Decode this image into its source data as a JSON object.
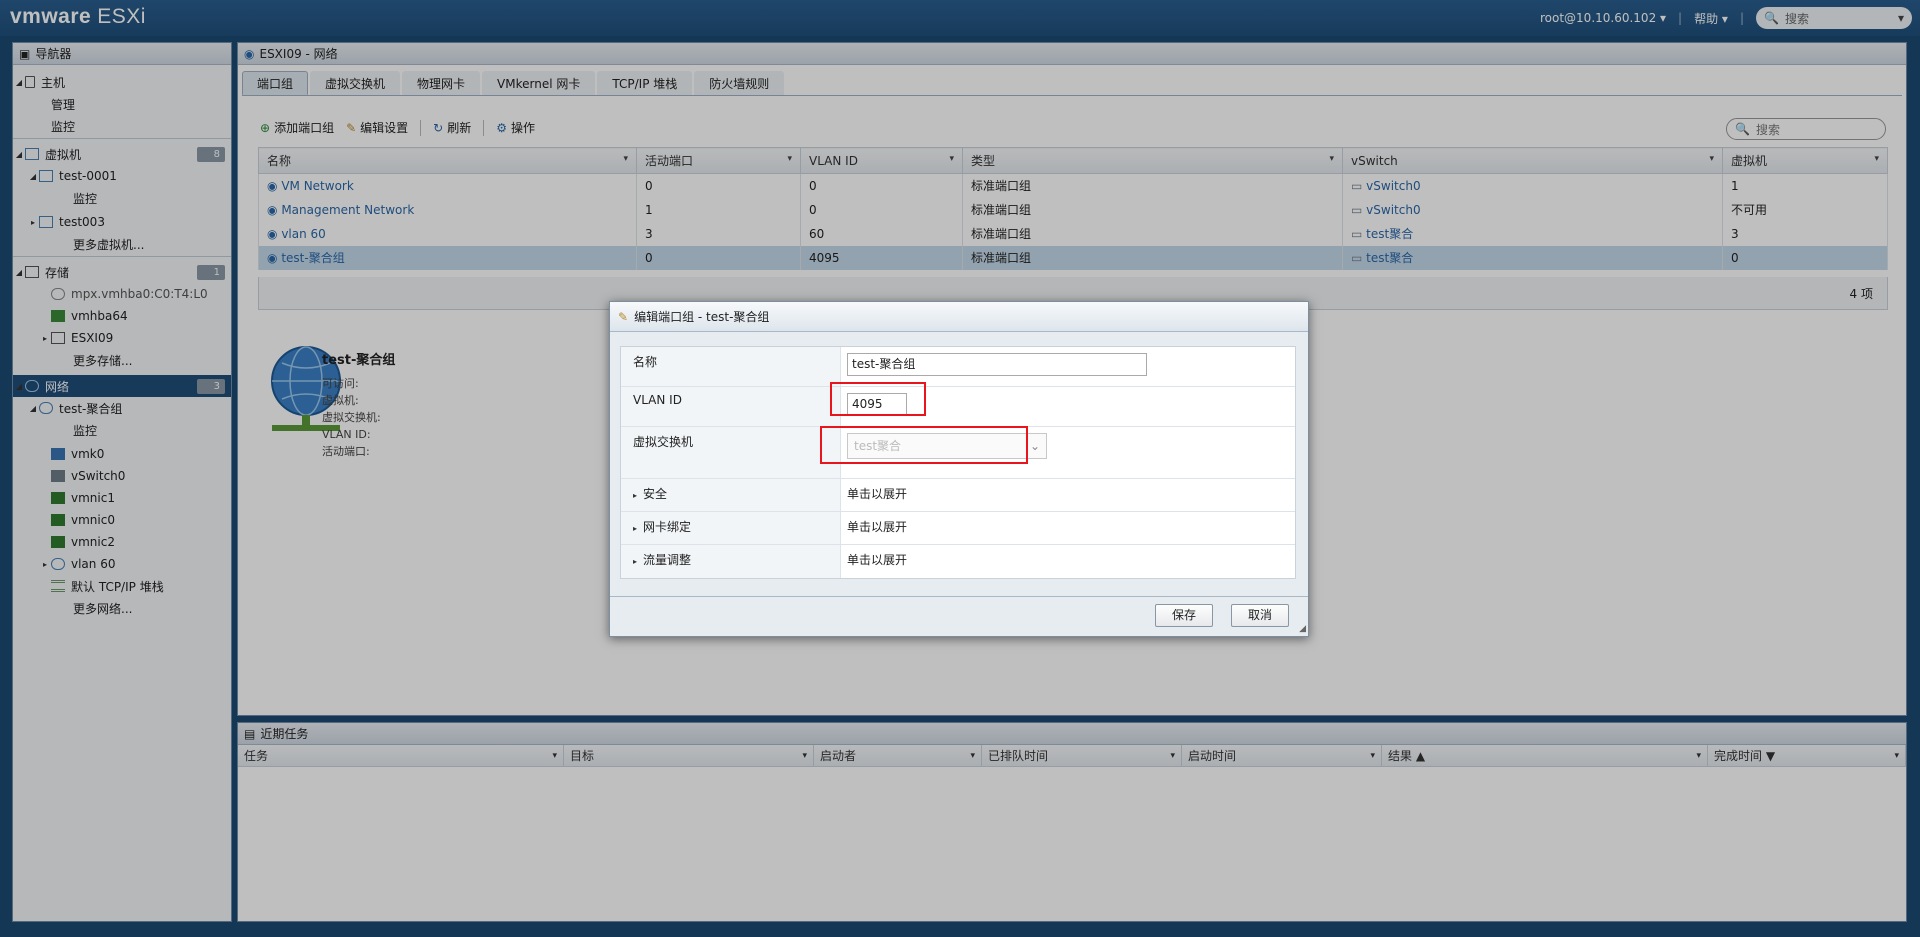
{
  "header": {
    "brand": "vmware",
    "product": "ESXi",
    "user": "root@10.10.60.102",
    "help": "帮助",
    "search_placeholder": "搜索"
  },
  "navigator": {
    "title": "导航器",
    "items": [
      {
        "label": "主机"
      },
      {
        "label": "管理"
      },
      {
        "label": "监控"
      },
      {
        "label": "虚拟机",
        "badge": "8"
      },
      {
        "label": "test-0001"
      },
      {
        "label": "监控"
      },
      {
        "label": "test003"
      },
      {
        "label": "更多虚拟机..."
      },
      {
        "label": "存储",
        "badge": "1"
      },
      {
        "label": "mpx.vmhba0:C0:T4:L0"
      },
      {
        "label": "vmhba64"
      },
      {
        "label": "ESXI09"
      },
      {
        "label": "更多存储..."
      },
      {
        "label": "网络",
        "badge": "3"
      },
      {
        "label": "test-聚合组"
      },
      {
        "label": "监控"
      },
      {
        "label": "vmk0"
      },
      {
        "label": "vSwitch0"
      },
      {
        "label": "vmnic1"
      },
      {
        "label": "vmnic0"
      },
      {
        "label": "vmnic2"
      },
      {
        "label": "vlan 60"
      },
      {
        "label": "默认 TCP/IP 堆栈"
      },
      {
        "label": "更多网络..."
      }
    ]
  },
  "main": {
    "title": "ESXI09 - 网络",
    "tabs": [
      "端口组",
      "虚拟交换机",
      "物理网卡",
      "VMkernel 网卡",
      "TCP/IP 堆栈",
      "防火墙规则"
    ],
    "toolbar": {
      "add": "添加端口组",
      "edit": "编辑设置",
      "refresh": "刷新",
      "actions": "操作"
    },
    "search_placeholder": "搜索",
    "columns": [
      "名称",
      "活动端口",
      "VLAN ID",
      "类型",
      "vSwitch",
      "虚拟机"
    ],
    "rows": [
      {
        "name": "VM Network",
        "ports": "0",
        "vlan": "0",
        "type": "标准端口组",
        "vswitch": "vSwitch0",
        "vms": "1"
      },
      {
        "name": "Management Network",
        "ports": "1",
        "vlan": "0",
        "type": "标准端口组",
        "vswitch": "vSwitch0",
        "vms": "不可用"
      },
      {
        "name": "vlan 60",
        "ports": "3",
        "vlan": "60",
        "type": "标准端口组",
        "vswitch": "test聚合",
        "vms": "3"
      },
      {
        "name": "test-聚合组",
        "ports": "0",
        "vlan": "4095",
        "type": "标准端口组",
        "vswitch": "test聚合",
        "vms": "0"
      }
    ],
    "count": "4 项",
    "detail": {
      "title": "test-聚合组",
      "fields": [
        "可访问:",
        "虚拟机:",
        "虚拟交换机:",
        "VLAN ID:",
        "活动端口:"
      ]
    }
  },
  "tasks": {
    "title": "近期任务",
    "columns": [
      "任务",
      "目标",
      "启动者",
      "已排队时间",
      "启动时间",
      "结果 ▲",
      "完成时间 ▼"
    ]
  },
  "dialog": {
    "title": "编辑端口组 - test-聚合组",
    "name_label": "名称",
    "name_value": "test-聚合组",
    "vlan_label": "VLAN ID",
    "vlan_value": "4095",
    "vswitch_label": "虚拟交换机",
    "vswitch_value": "test聚合",
    "security_label": "安全",
    "nic_label": "网卡绑定",
    "traffic_label": "流量调整",
    "expand_hint": "单击以展开",
    "save": "保存",
    "cancel": "取消"
  },
  "colors": {
    "header": "#1f4f7b",
    "selected_nav": "#1f4c78",
    "selected_row": "#c5d9ea",
    "highlight": "#e8161c",
    "link": "#2a67a8"
  }
}
